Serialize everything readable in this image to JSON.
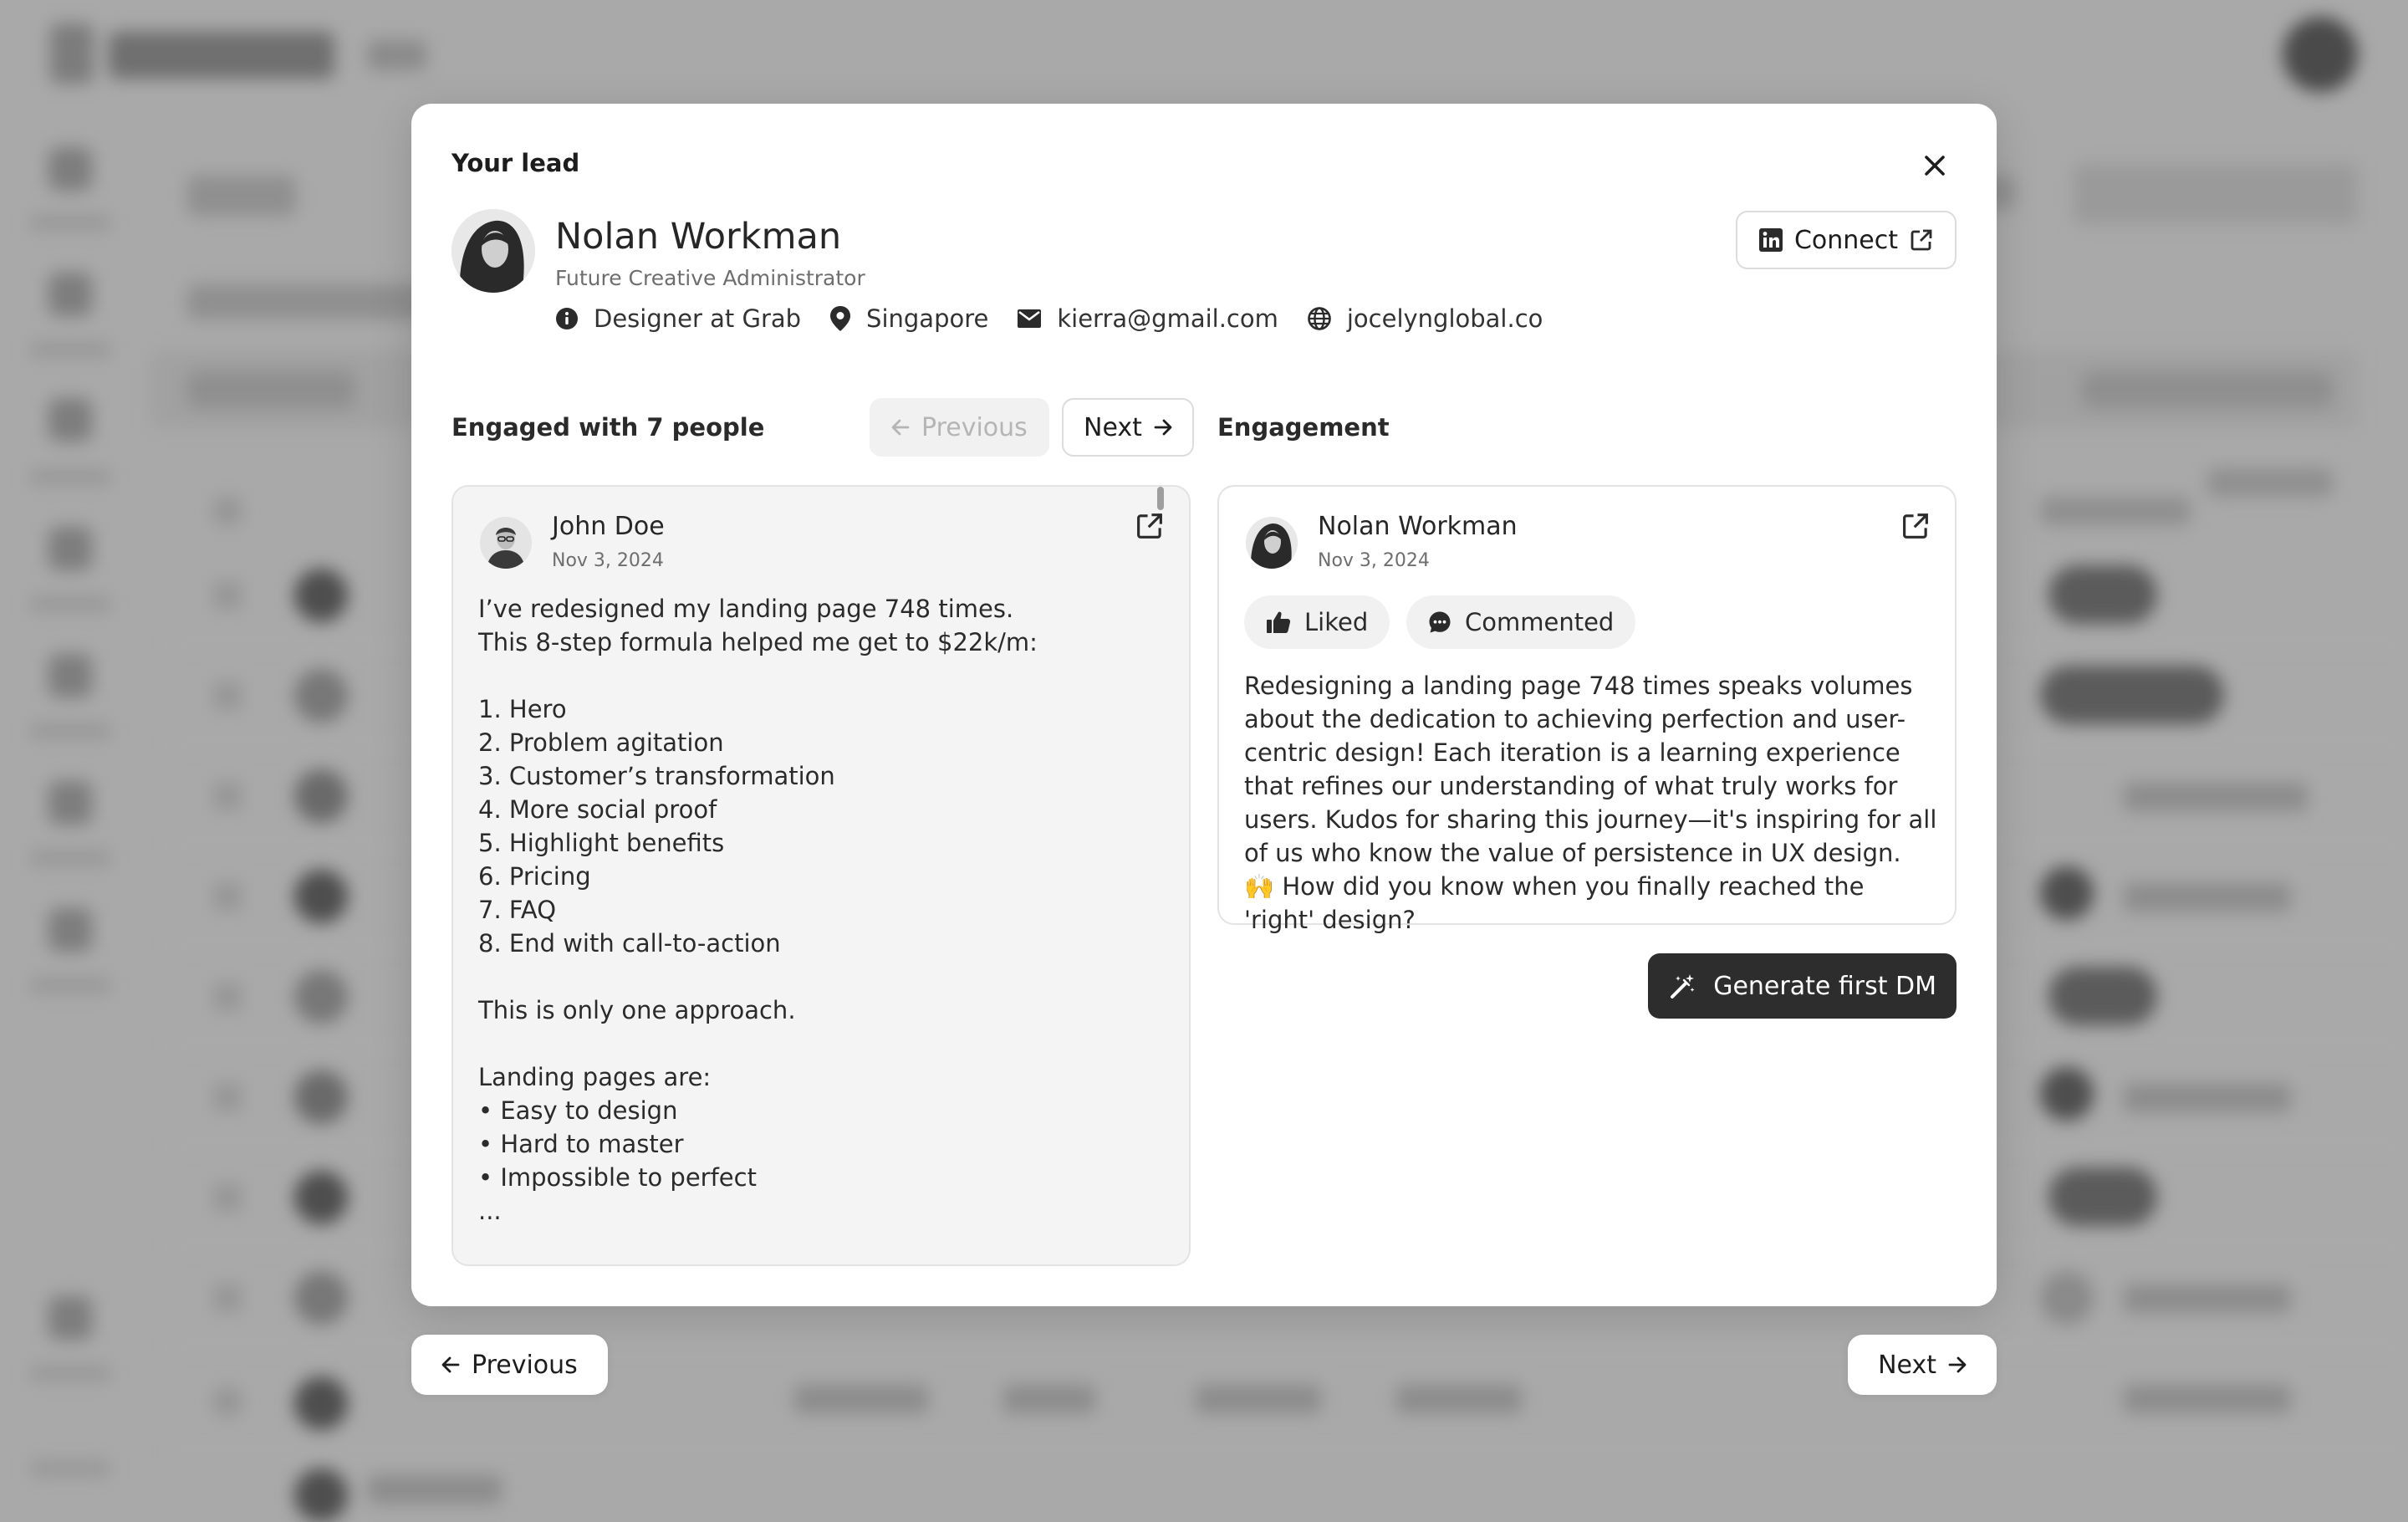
{
  "modal": {
    "header_label": "Your lead",
    "lead": {
      "name": "Nolan Workman",
      "title": "Future Creative Administrator",
      "role": "Designer at Grab",
      "location": "Singapore",
      "email": "kierra@gmail.com",
      "website": "jocelynglobal.co",
      "connect_label": "Connect"
    },
    "engaged": {
      "label": "Engaged with 7 people",
      "previous_label": "Previous",
      "next_label": "Next"
    },
    "post": {
      "author": "John Doe",
      "date": "Nov 3, 2024",
      "lines": [
        "I’ve redesigned my landing page 748 times.",
        "This 8-step formula helped me get to $22k/m:",
        "",
        "1. Hero",
        "2. Problem agitation",
        "3. Customer’s transformation",
        "4. More social proof",
        "5. Highlight benefits",
        "6. Pricing",
        "7. FAQ",
        "8. End with call-to-action",
        "",
        "This is only one approach.",
        "",
        "Landing pages are:",
        "• Easy to design",
        "• Hard to master",
        "• Impossible to perfect",
        "..."
      ]
    },
    "engagement": {
      "label": "Engagement",
      "author": "Nolan Workman",
      "date": "Nov 3, 2024",
      "liked_label": "Liked",
      "commented_label": "Commented",
      "comment": "Redesigning a landing page 748 times speaks volumes about the dedication to achieving perfection and user-centric design! Each iteration is a learning experience that refines our understanding of what truly works for users. Kudos for sharing this journey—it's inspiring for all of us who know the value of persistence in UX design. 🙌 How did you know when you finally reached the 'right' design?"
    },
    "generate_label": "Generate first DM"
  },
  "footer": {
    "previous_label": "Previous",
    "next_label": "Next"
  },
  "icons": {
    "close": "close-icon",
    "info": "info-icon",
    "location": "location-pin-icon",
    "email": "mail-icon",
    "website": "globe-icon",
    "linkedin": "linkedin-icon",
    "external": "external-link-icon",
    "arrow_left": "arrow-left-icon",
    "arrow_right": "arrow-right-icon",
    "thumbs_up": "thumbs-up-icon",
    "comment": "comment-icon",
    "magic_wand": "magic-wand-icon"
  },
  "colors": {
    "overlay": "#a9a9a9",
    "primary_button": "#2d2d2d",
    "card_muted": "#f4f4f4"
  }
}
